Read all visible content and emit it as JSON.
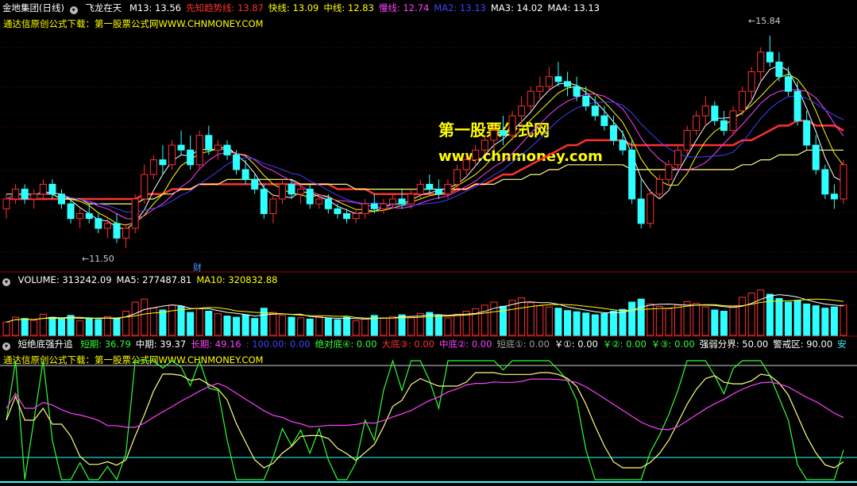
{
  "main_header": {
    "title": "金地集团(日线)",
    "indicator": "飞龙在天",
    "items": [
      {
        "text": "M13: 13.56",
        "color": "#ffffff"
      },
      {
        "text": "先知趋势线: 13.87",
        "color": "#ff3030"
      },
      {
        "text": "快线: 13.09",
        "color": "#ffff00"
      },
      {
        "text": "中线: 12.83",
        "color": "#ffff00"
      },
      {
        "text": "慢线: 12.74",
        "color": "#ff40ff"
      },
      {
        "text": "MA2: 13.13",
        "color": "#4040ff"
      },
      {
        "text": "MA3: 14.02",
        "color": "#ffffff"
      },
      {
        "text": "MA4: 13.13",
        "color": "#ffffff"
      }
    ]
  },
  "source_note": "通达信原创公式下载：第一股票公式网WWW.CHNMONEY.COM",
  "watermark": {
    "line1": "第一股票公式网",
    "line2": "www.chnmoney.com"
  },
  "price_labels": {
    "high": "15.84",
    "low": "11.50",
    "marker": "财"
  },
  "volume_header": {
    "items": [
      {
        "text": "VOLUME: 313242.09",
        "color": "#ffffff"
      },
      {
        "text": "MA5: 277487.81",
        "color": "#ffffff"
      },
      {
        "text": "MA10: 320832.88",
        "color": "#ffff00"
      }
    ]
  },
  "oscillator_header": {
    "title": "短绝底强升追",
    "items": [
      {
        "text": "短期: 36.79",
        "color": "#30ff30"
      },
      {
        "text": "中期: 39.37",
        "color": "#ffffff"
      },
      {
        "text": "长期: 49.16",
        "color": "#ff40ff"
      },
      {
        "text": ": 100.00: 0.00",
        "color": "#4040ff"
      },
      {
        "text": "绝对底④: 0.00",
        "color": "#30ff30"
      },
      {
        "text": "大底③: 0.00",
        "color": "#ff3030"
      },
      {
        "text": "中底②: 0.00",
        "color": "#ff40ff"
      },
      {
        "text": "短底①: 0.00",
        "color": "#a0a0a0"
      },
      {
        "text": "￥①: 0.00",
        "color": "#ffffff"
      },
      {
        "text": "￥②: 0.00",
        "color": "#30ff30"
      },
      {
        "text": "￥③: 0.00",
        "color": "#30ff30"
      },
      {
        "text": "强弱分界: 50.00",
        "color": "#ffffff"
      },
      {
        "text": "警戒区: 90.00",
        "color": "#ffffff"
      },
      {
        "text": "安",
        "color": "#30ffff"
      }
    ]
  },
  "oscillator_note": "通达信原创公式下载：第一股票公式网WWW.CHNMONEY.COM",
  "chart_data": {
    "type": "candlestick",
    "ohlc": [
      [
        12.3,
        12.6,
        12.1,
        12.5
      ],
      [
        12.5,
        12.8,
        12.4,
        12.7
      ],
      [
        12.7,
        12.8,
        12.4,
        12.5
      ],
      [
        12.5,
        12.7,
        12.3,
        12.6
      ],
      [
        12.6,
        12.9,
        12.5,
        12.8
      ],
      [
        12.8,
        12.9,
        12.5,
        12.6
      ],
      [
        12.6,
        12.7,
        12.3,
        12.4
      ],
      [
        12.4,
        12.5,
        12.0,
        12.1
      ],
      [
        12.1,
        12.3,
        11.9,
        12.2
      ],
      [
        12.2,
        12.4,
        12.0,
        12.1
      ],
      [
        12.1,
        12.2,
        11.8,
        11.9
      ],
      [
        11.9,
        12.1,
        11.7,
        12.0
      ],
      [
        12.0,
        12.2,
        11.6,
        11.7
      ],
      [
        11.7,
        12.0,
        11.5,
        11.9
      ],
      [
        11.9,
        12.6,
        11.8,
        12.5
      ],
      [
        12.5,
        13.2,
        12.4,
        13.0
      ],
      [
        13.0,
        13.4,
        12.9,
        13.3
      ],
      [
        13.3,
        13.6,
        13.0,
        13.2
      ],
      [
        13.2,
        13.7,
        13.1,
        13.6
      ],
      [
        13.6,
        13.9,
        13.4,
        13.5
      ],
      [
        13.5,
        13.8,
        13.1,
        13.2
      ],
      [
        13.2,
        13.9,
        13.1,
        13.8
      ],
      [
        13.8,
        14.0,
        13.4,
        13.5
      ],
      [
        13.5,
        13.7,
        13.3,
        13.6
      ],
      [
        13.6,
        13.7,
        13.3,
        13.4
      ],
      [
        13.4,
        13.5,
        13.0,
        13.1
      ],
      [
        13.1,
        13.3,
        12.8,
        12.9
      ],
      [
        12.9,
        13.0,
        12.6,
        12.7
      ],
      [
        12.7,
        12.8,
        12.1,
        12.2
      ],
      [
        12.2,
        12.6,
        12.0,
        12.5
      ],
      [
        12.5,
        12.9,
        12.4,
        12.8
      ],
      [
        12.8,
        12.9,
        12.5,
        12.6
      ],
      [
        12.6,
        12.8,
        12.4,
        12.7
      ],
      [
        12.7,
        12.8,
        12.3,
        12.4
      ],
      [
        12.4,
        12.6,
        12.3,
        12.5
      ],
      [
        12.5,
        12.6,
        12.2,
        12.3
      ],
      [
        12.3,
        12.4,
        12.1,
        12.2
      ],
      [
        12.2,
        12.3,
        12.0,
        12.1
      ],
      [
        12.1,
        12.3,
        12.0,
        12.2
      ],
      [
        12.2,
        12.5,
        12.1,
        12.4
      ],
      [
        12.4,
        12.6,
        12.2,
        12.3
      ],
      [
        12.3,
        12.5,
        12.2,
        12.4
      ],
      [
        12.4,
        12.6,
        12.3,
        12.5
      ],
      [
        12.5,
        12.7,
        12.3,
        12.4
      ],
      [
        12.4,
        12.7,
        12.3,
        12.6
      ],
      [
        12.6,
        12.9,
        12.5,
        12.8
      ],
      [
        12.8,
        13.0,
        12.6,
        12.7
      ],
      [
        12.7,
        12.9,
        12.5,
        12.6
      ],
      [
        12.6,
        12.9,
        12.5,
        12.8
      ],
      [
        12.8,
        13.2,
        12.7,
        13.1
      ],
      [
        13.1,
        13.4,
        13.0,
        13.3
      ],
      [
        13.3,
        13.6,
        13.2,
        13.5
      ],
      [
        13.5,
        13.8,
        13.4,
        13.7
      ],
      [
        13.7,
        14.0,
        13.5,
        13.9
      ],
      [
        13.9,
        14.2,
        13.6,
        13.8
      ],
      [
        13.8,
        14.3,
        13.7,
        14.2
      ],
      [
        14.2,
        14.6,
        14.0,
        14.4
      ],
      [
        14.4,
        14.8,
        14.3,
        14.7
      ],
      [
        14.7,
        15.0,
        14.5,
        14.8
      ],
      [
        14.8,
        15.2,
        14.7,
        15.0
      ],
      [
        15.0,
        15.3,
        14.8,
        14.9
      ],
      [
        14.9,
        15.1,
        14.6,
        14.8
      ],
      [
        14.8,
        15.0,
        14.5,
        14.6
      ],
      [
        14.6,
        14.8,
        14.3,
        14.4
      ],
      [
        14.4,
        14.6,
        14.1,
        14.2
      ],
      [
        14.2,
        14.4,
        13.9,
        14.0
      ],
      [
        14.0,
        14.2,
        13.6,
        13.7
      ],
      [
        13.7,
        13.9,
        13.4,
        13.5
      ],
      [
        13.5,
        13.7,
        12.4,
        12.5
      ],
      [
        12.5,
        12.9,
        11.9,
        12.0
      ],
      [
        12.0,
        12.7,
        11.9,
        12.6
      ],
      [
        12.6,
        13.0,
        12.5,
        12.9
      ],
      [
        12.9,
        13.3,
        12.8,
        13.2
      ],
      [
        13.2,
        13.6,
        13.1,
        13.5
      ],
      [
        13.5,
        14.0,
        13.4,
        13.9
      ],
      [
        13.9,
        14.3,
        13.8,
        14.2
      ],
      [
        14.2,
        14.6,
        14.0,
        14.4
      ],
      [
        14.4,
        14.5,
        14.0,
        14.1
      ],
      [
        14.1,
        14.3,
        13.8,
        13.9
      ],
      [
        13.9,
        14.4,
        13.8,
        14.3
      ],
      [
        14.3,
        14.8,
        14.2,
        14.7
      ],
      [
        14.7,
        15.2,
        14.5,
        15.1
      ],
      [
        15.1,
        15.6,
        14.9,
        15.5
      ],
      [
        15.5,
        15.84,
        15.2,
        15.3
      ],
      [
        15.3,
        15.5,
        14.9,
        15.0
      ],
      [
        15.0,
        15.2,
        14.6,
        14.7
      ],
      [
        14.7,
        14.9,
        14.0,
        14.1
      ],
      [
        14.1,
        14.3,
        13.5,
        13.6
      ],
      [
        13.6,
        13.8,
        13.0,
        13.1
      ],
      [
        13.1,
        13.2,
        12.5,
        12.6
      ],
      [
        12.6,
        12.8,
        12.3,
        12.5
      ],
      [
        12.5,
        13.3,
        12.4,
        13.2
      ]
    ],
    "ma_series": [
      {
        "name": "先知趋势线",
        "color": "#ff3030",
        "values": [
          12.5,
          12.5,
          12.5,
          12.5,
          12.5,
          12.5,
          12.5,
          12.5,
          12.5,
          12.5,
          12.5,
          12.5,
          12.5,
          12.5,
          12.5,
          12.6,
          12.6,
          12.6,
          12.7,
          12.7,
          12.7,
          12.8,
          12.8,
          12.8,
          12.8,
          12.8,
          12.8,
          12.8,
          12.8,
          12.8,
          12.8,
          12.8,
          12.8,
          12.8,
          12.8,
          12.8,
          12.7,
          12.7,
          12.7,
          12.7,
          12.6,
          12.6,
          12.6,
          12.6,
          12.6,
          12.6,
          12.6,
          12.6,
          12.6,
          12.7,
          12.7,
          12.8,
          12.8,
          12.9,
          13.0,
          13.0,
          13.1,
          13.2,
          13.3,
          13.4,
          13.5,
          13.6,
          13.6,
          13.7,
          13.7,
          13.7,
          13.7,
          13.7,
          13.6,
          13.6,
          13.6,
          13.6,
          13.6,
          13.6,
          13.6,
          13.6,
          13.6,
          13.6,
          13.6,
          13.6,
          13.7,
          13.7,
          13.8,
          13.9,
          14.0,
          14.0,
          14.1,
          14.1,
          14.0,
          14.0,
          14.0,
          13.9
        ]
      },
      {
        "name": "MA3",
        "color": "#ffff80",
        "values": [
          12.6,
          12.6,
          12.6,
          12.6,
          12.6,
          12.6,
          12.5,
          12.5,
          12.5,
          12.4,
          12.4,
          12.4,
          12.4,
          12.4,
          12.4,
          12.5,
          12.5,
          12.6,
          12.6,
          12.7,
          12.7,
          12.8,
          12.8,
          12.8,
          12.9,
          12.9,
          12.9,
          12.9,
          12.9,
          12.9,
          12.9,
          12.9,
          12.8,
          12.8,
          12.8,
          12.8,
          12.8,
          12.8,
          12.7,
          12.7,
          12.7,
          12.7,
          12.7,
          12.7,
          12.7,
          12.7,
          12.7,
          12.7,
          12.7,
          12.7,
          12.7,
          12.8,
          12.8,
          12.8,
          12.9,
          12.9,
          12.9,
          13.0,
          13.0,
          13.1,
          13.1,
          13.2,
          13.2,
          13.2,
          13.2,
          13.2,
          13.2,
          13.2,
          13.1,
          13.1,
          13.1,
          13.1,
          13.1,
          13.1,
          13.1,
          13.1,
          13.1,
          13.1,
          13.1,
          13.1,
          13.2,
          13.2,
          13.3,
          13.3,
          13.4,
          13.4,
          13.4,
          13.5,
          13.5,
          13.5,
          13.5,
          13.5
        ]
      }
    ],
    "volume": [
      22,
      30,
      28,
      25,
      35,
      30,
      27,
      33,
      24,
      29,
      26,
      31,
      28,
      40,
      55,
      60,
      45,
      42,
      50,
      48,
      38,
      44,
      40,
      36,
      32,
      30,
      34,
      28,
      45,
      38,
      33,
      30,
      29,
      27,
      31,
      28,
      26,
      30,
      24,
      27,
      33,
      29,
      31,
      34,
      30,
      36,
      38,
      33,
      29,
      35,
      40,
      44,
      50,
      55,
      48,
      58,
      62,
      54,
      49,
      47,
      45,
      41,
      39,
      37,
      34,
      36,
      40,
      43,
      55,
      60,
      52,
      48,
      44,
      50,
      56,
      53,
      47,
      42,
      40,
      49,
      63,
      70,
      75,
      68,
      61,
      55,
      58,
      52,
      49,
      45,
      47,
      50
    ]
  }
}
